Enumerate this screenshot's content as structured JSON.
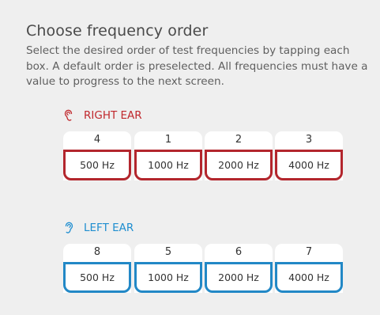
{
  "title": "Choose frequency order",
  "description_lines": [
    "Select the desired order of test frequencies by tapping each",
    "box. A default order is preselected. All frequencies must have a",
    "value to progress to the next screen."
  ],
  "colors": {
    "right_ear": "#c0282d",
    "left_ear": "#1f8ed0"
  },
  "right_ear": {
    "label": "RIGHT EAR",
    "icon": "ear-icon",
    "cards": [
      {
        "order": "4",
        "freq": "500 Hz"
      },
      {
        "order": "1",
        "freq": "1000 Hz"
      },
      {
        "order": "2",
        "freq": "2000 Hz"
      },
      {
        "order": "3",
        "freq": "4000 Hz"
      }
    ]
  },
  "left_ear": {
    "label": "LEFT EAR",
    "icon": "ear-icon",
    "cards": [
      {
        "order": "8",
        "freq": "500 Hz"
      },
      {
        "order": "5",
        "freq": "1000 Hz"
      },
      {
        "order": "6",
        "freq": "2000 Hz"
      },
      {
        "order": "7",
        "freq": "4000 Hz"
      }
    ]
  }
}
